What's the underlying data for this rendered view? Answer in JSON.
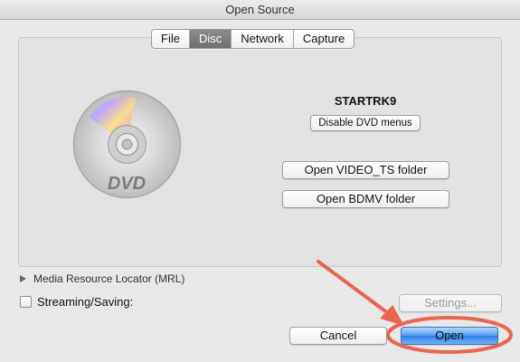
{
  "window": {
    "title": "Open Source"
  },
  "tabs": [
    {
      "label": "File",
      "active": false
    },
    {
      "label": "Disc",
      "active": true
    },
    {
      "label": "Network",
      "active": false
    },
    {
      "label": "Capture",
      "active": false
    }
  ],
  "disc_panel": {
    "disc_icon": "dvd-disc-icon",
    "disc_logo_text": "DVD",
    "disc_name": "STARTRK9",
    "disable_menus_label": "Disable DVD menus",
    "open_video_ts_label": "Open VIDEO_TS folder",
    "open_bdmv_label": "Open BDMV folder"
  },
  "mrl": {
    "label": "Media Resource Locator (MRL)",
    "icon": "disclosure-triangle-icon"
  },
  "streaming": {
    "label": "Streaming/Saving:",
    "checked": false,
    "settings_label": "Settings..."
  },
  "actions": {
    "cancel_label": "Cancel",
    "open_label": "Open"
  },
  "annotation": {
    "color": "#e8664f"
  }
}
